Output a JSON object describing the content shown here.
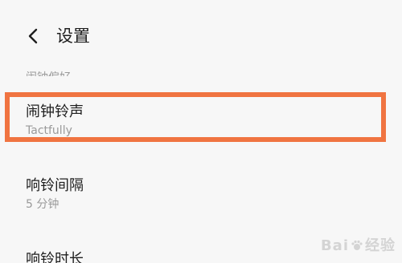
{
  "header": {
    "back_icon": "chevron-left-icon",
    "title": "设置"
  },
  "section": {
    "label": "闹钟偏好"
  },
  "items": [
    {
      "title": "闹钟铃声",
      "subtitle": "Tactfully"
    },
    {
      "title": "响铃间隔",
      "subtitle": "5 分钟"
    },
    {
      "title": "响铃时长"
    }
  ],
  "highlight": {
    "color": "#f07441"
  },
  "watermark": {
    "text_left": "Bai",
    "text_right": "经验",
    "icon": "paw-icon"
  }
}
